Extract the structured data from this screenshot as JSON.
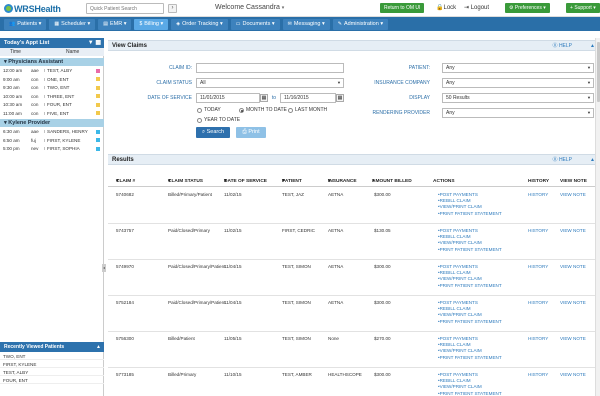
{
  "header": {
    "logo": "WRSHealth",
    "quick_search_placeholder": "Quick Patient Search",
    "search_go": "›",
    "welcome": "Welcome Cassandra",
    "return_label": "Return to OM UI",
    "lock_label": "Lock",
    "logout_label": "Logout",
    "preferences_label": "Preferences",
    "support_label": "Support"
  },
  "nav": {
    "items": [
      {
        "label": "Patients"
      },
      {
        "label": "Scheduler"
      },
      {
        "label": "EMR"
      },
      {
        "label": "Billing"
      },
      {
        "label": "Order Tracking"
      },
      {
        "label": "Documents"
      },
      {
        "label": "Messaging"
      },
      {
        "label": "Administration"
      }
    ]
  },
  "sidebar": {
    "title": "Today's Appt List",
    "col_time": "Time",
    "col_name": "Name",
    "providers": [
      {
        "name": "Physicians Assistant",
        "appts": [
          {
            "time": "12:00 am",
            "type": "aae",
            "name": "TEST, ALBY",
            "color": "#e96aa8"
          },
          {
            "time": "9:00 am",
            "type": "con",
            "name": "ONE, ENT",
            "color": "#f2c94c"
          },
          {
            "time": "9:30 am",
            "type": "con",
            "name": "TWO, ENT",
            "color": "#f2c94c"
          },
          {
            "time": "10:00 am",
            "type": "con",
            "name": "THREE, ENT",
            "color": "#f2c94c"
          },
          {
            "time": "10:30 am",
            "type": "con",
            "name": "FOUR, ENT",
            "color": "#f2c94c"
          },
          {
            "time": "11:00 am",
            "type": "con",
            "name": "FIVE, ENT",
            "color": "#f2c94c"
          }
        ]
      },
      {
        "name": "Kylene Provider",
        "appts": [
          {
            "time": "6:30 am",
            "type": "aae",
            "name": "SANDERS, HENRY",
            "color": "#3cb8e8"
          },
          {
            "time": "6:50 am",
            "type": "fuj",
            "name": "FIRST, KYLENE",
            "color": "#3cb8e8"
          },
          {
            "time": "5:00 pm",
            "type": "nev",
            "name": "FIRST, SOPHIA",
            "color": "#3cb8e8"
          }
        ]
      }
    ],
    "recent_title": "Recently Viewed Patients",
    "recent": [
      "TWO, ENT",
      "FIRST, KYLENE",
      "TEST, ALBY",
      "FOUR, ENT"
    ]
  },
  "view_claims": {
    "title": "View Claims",
    "help": "HELP",
    "claim_id_label": "CLAIM ID:",
    "claim_status_label": "CLAIM STATUS",
    "claim_status_value": "All",
    "date_of_service_label": "DATE OF SERVICE",
    "date_from": "11/01/2015",
    "date_to_label": "to",
    "date_to": "11/16/2015",
    "radio_today": "TODAY",
    "radio_month": "MONTH TO DATE",
    "radio_last_month": "LAST MONTH",
    "radio_year": "YEAR TO DATE",
    "patient_label": "PATIENT:",
    "patient_value": "Any",
    "insurance_label": "INSURANCE COMPANY",
    "insurance_value": "Any",
    "display_label": "DISPLAY",
    "display_value": "50 Results",
    "rendering_label": "RENDERING PROVIDER",
    "rendering_value": "Any",
    "search_label": "Search",
    "print_label": "Print"
  },
  "results": {
    "title": "Results",
    "help": "HELP",
    "columns": {
      "claim": "CLAIM #",
      "status": "CLAIM STATUS",
      "dos": "DATE OF SERVICE",
      "patient": "PATIENT",
      "insurance": "INSURANCE",
      "amount": "AMOUNT BILLED",
      "actions": "ACTIONS",
      "history": "HISTORY",
      "view_note": "VIEW NOTE"
    },
    "rows": [
      {
        "claim": "5740682",
        "status": "Billed/Primary/Patient",
        "dos": "11/02/15",
        "patient": "TEST, JAZ",
        "insurance": "AETNA",
        "amount": "$300.00",
        "history": "HISTORY",
        "note": "VIEW NOTE"
      },
      {
        "claim": "5743757",
        "status": "Paid/Closed/Primary",
        "dos": "11/02/15",
        "patient": "FIRST, CEDRIC",
        "insurance": "AETNA",
        "amount": "$130.05",
        "history": "HISTORY",
        "note": "VIEW NOTE"
      },
      {
        "claim": "5749970",
        "status": "Paid/Closed/Primary/Patient",
        "dos": "11/04/15",
        "patient": "TEST, SIMON",
        "insurance": "AETNA",
        "amount": "$300.00",
        "history": "HISTORY",
        "note": "VIEW NOTE"
      },
      {
        "claim": "5752184",
        "status": "Paid/Closed/Primary/Patient",
        "dos": "11/04/15",
        "patient": "TEST, SIMON",
        "insurance": "AETNA",
        "amount": "$300.00",
        "history": "HISTORY",
        "note": "VIEW NOTE"
      },
      {
        "claim": "5756300",
        "status": "Billed/Patient",
        "dos": "11/05/15",
        "patient": "TEST, SIMON",
        "insurance": "None",
        "amount": "$270.00",
        "history": "HISTORY",
        "note": "VIEW NOTE"
      },
      {
        "claim": "5773185",
        "status": "Billed/Primary",
        "dos": "11/10/15",
        "patient": "TEST, AMBER",
        "insurance": "HEALTHSCOPE",
        "amount": "$300.00",
        "history": "HISTORY",
        "note": "VIEW NOTE"
      }
    ],
    "actions": [
      "POST PAYMENTS",
      "REBILL CLAIM",
      "VIEW/PRINT CLAIM",
      "PRINT PATIENT STATEMENT"
    ]
  }
}
